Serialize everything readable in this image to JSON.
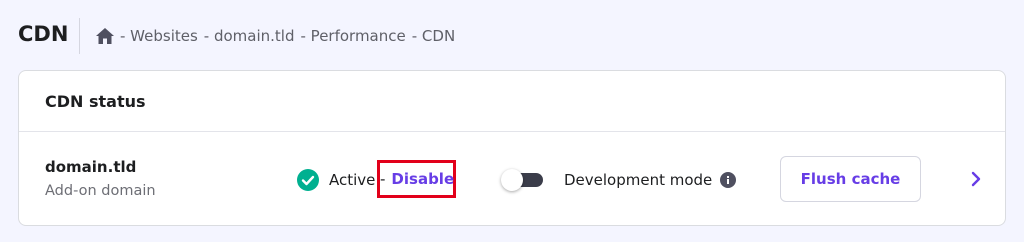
{
  "header": {
    "title": "CDN",
    "breadcrumb": [
      "- Websites",
      "- domain.tld",
      "- Performance",
      "- CDN"
    ],
    "home_icon": "home-icon"
  },
  "card": {
    "title": "CDN status",
    "domain": {
      "name": "domain.tld",
      "type": "Add-on domain"
    },
    "status": {
      "label": "Active",
      "separator": "-",
      "action": "Disable",
      "icon": "check-circle-icon",
      "color": "#00b090"
    },
    "dev_mode": {
      "label": "Development mode",
      "enabled": false,
      "info_icon": "info-icon"
    },
    "flush_button": "Flush cache",
    "expand_icon": "chevron-right-icon"
  },
  "colors": {
    "accent": "#673de6",
    "highlight_border": "#e2001a",
    "background": "#f4f5ff"
  }
}
